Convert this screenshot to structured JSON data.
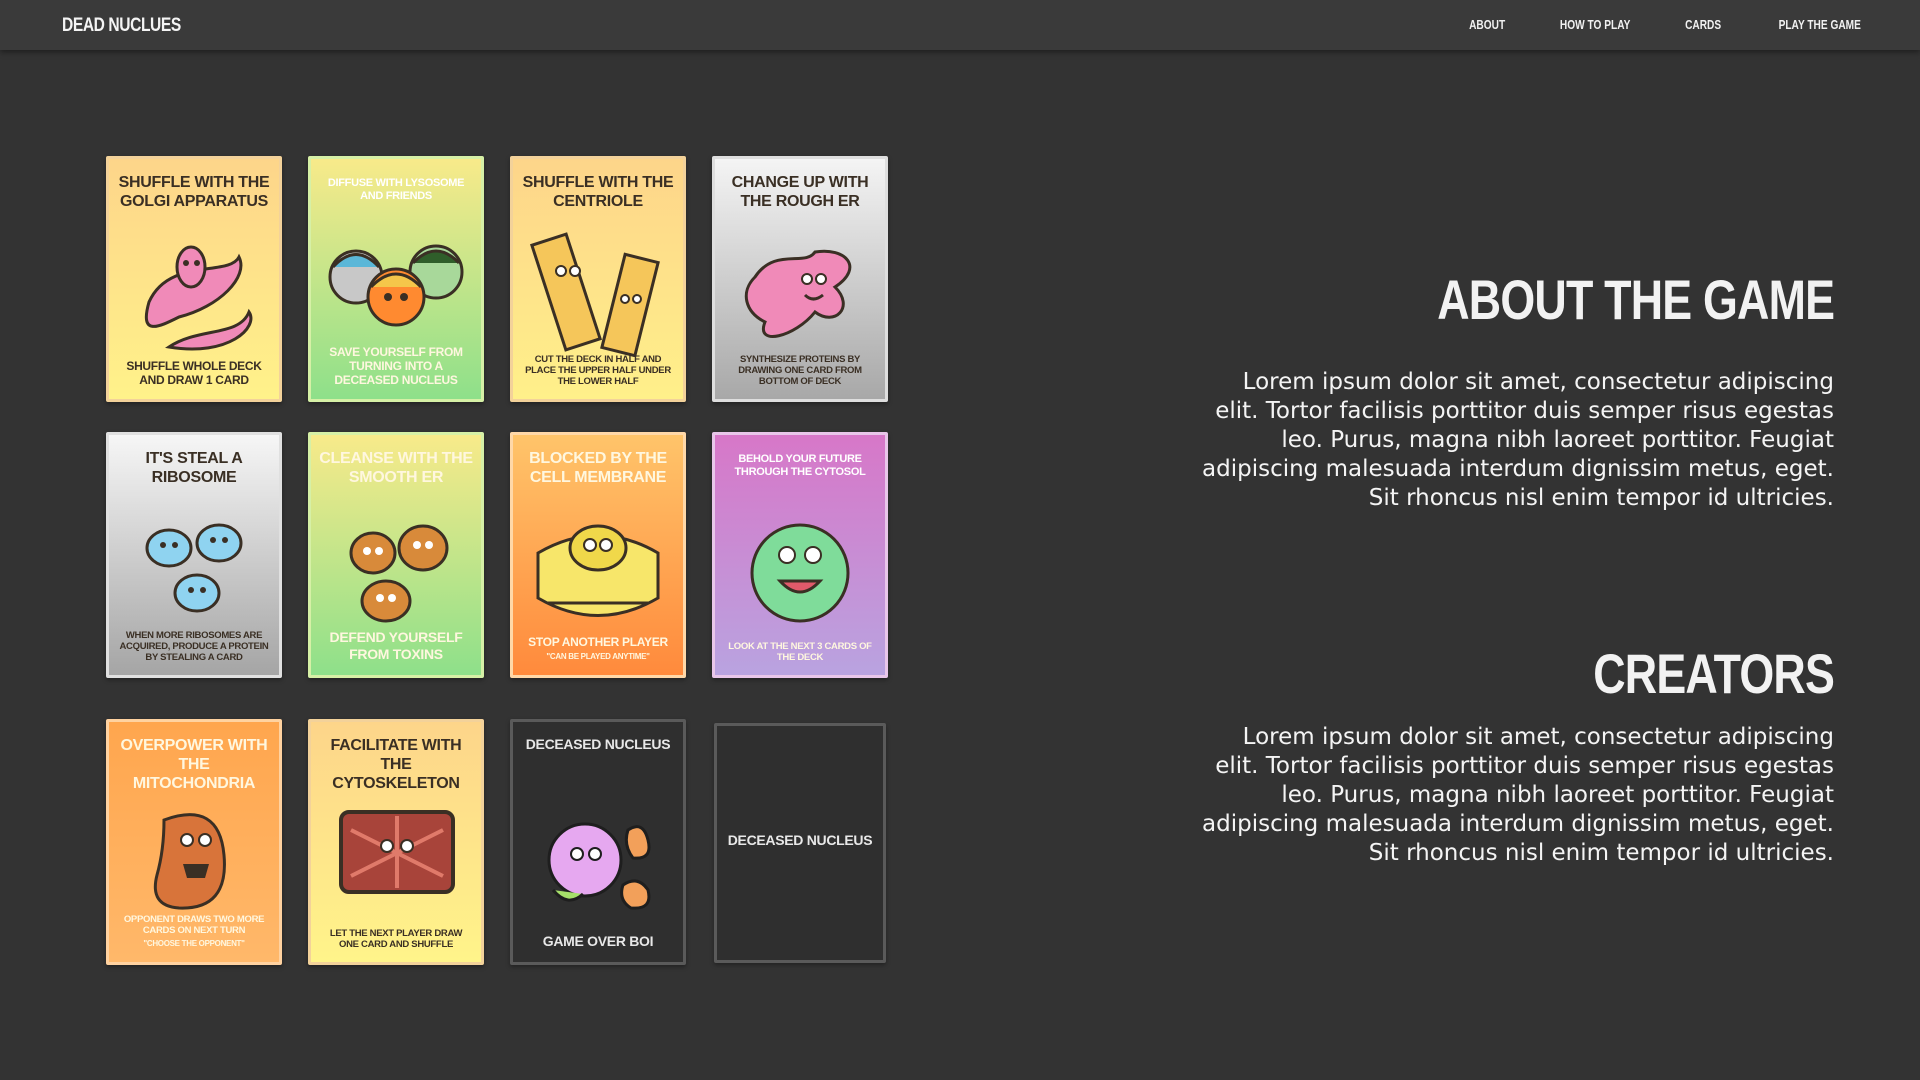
{
  "nav": {
    "brand": "DEAD NUCLUES",
    "links": [
      "ABOUT",
      "HOW TO PLAY",
      "CARDS",
      "PLAY THE GAME"
    ]
  },
  "cards": [
    {
      "title": "SHUFFLE WITH THE GOLGI APPARATUS",
      "footer": "SHUFFLE WHOLE DECK AND DRAW 1 CARD",
      "icon": "golgi-apparatus-icon"
    },
    {
      "title": "DIFFUSE WITH LYSOSOME AND FRIENDS",
      "footer": "SAVE YOURSELF FROM TURNING INTO A DECEASED NUCLEUS",
      "icon": "lysosome-icon"
    },
    {
      "title": "SHUFFLE WITH THE CENTRIOLE",
      "footer": "CUT THE DECK IN HALF AND PLACE THE UPPER HALF UNDER THE LOWER HALF",
      "icon": "centriole-icon"
    },
    {
      "title": "CHANGE UP WITH THE ROUGH ER",
      "footer": "SYNTHESIZE PROTEINS BY DRAWING ONE CARD FROM BOTTOM OF DECK",
      "icon": "rough-er-icon"
    },
    {
      "title": "IT'S STEAL A RIBOSOME",
      "footer": "WHEN MORE RIBOSOMES ARE ACQUIRED, PRODUCE A PROTEIN BY STEALING A CARD",
      "icon": "ribosome-icon"
    },
    {
      "title": "CLEANSE WITH THE SMOOTH ER",
      "footer": "DEFEND YOURSELF FROM TOXINS",
      "icon": "smooth-er-icon"
    },
    {
      "title": "BLOCKED BY THE CELL MEMBRANE",
      "footer": "STOP ANOTHER PLAYER",
      "note": "\"CAN BE PLAYED ANYTIME\"",
      "icon": "cell-membrane-icon"
    },
    {
      "title": "BEHOLD YOUR FUTURE THROUGH THE CYTOSOL",
      "footer": "LOOK AT THE NEXT 3 CARDS OF THE DECK",
      "icon": "cytosol-icon"
    },
    {
      "title": "OVERPOWER WITH THE MITOCHONDRIA",
      "footer": "OPPONENT DRAWS TWO MORE CARDS ON NEXT TURN",
      "note": "\"CHOOSE THE OPPONENT\"",
      "icon": "mitochondria-icon"
    },
    {
      "title": "FACILITATE WITH THE CYTOSKELETON",
      "footer": "LET THE NEXT PLAYER DRAW ONE CARD AND SHUFFLE",
      "icon": "cytoskeleton-icon"
    },
    {
      "title": "DECEASED NUCLEUS",
      "footer": "GAME OVER BOI",
      "icon": "deceased-nucleus-icon"
    },
    {
      "title": "DECEASED NUCLEUS",
      "footer": "",
      "icon": "card-back"
    }
  ],
  "about": {
    "heading": "ABOUT THE GAME",
    "text": "Lorem ipsum dolor sit amet, consectetur adipiscing elit. Tortor facilisis porttitor duis semper risus egestas leo. Purus, magna nibh laoreet porttitor. Feugiat adipiscing malesuada interdum dignissim metus, eget. Sit rhoncus nisl enim tempor id ultricies."
  },
  "creators": {
    "heading": "CREATORS",
    "text": "Lorem ipsum dolor sit amet, consectetur adipiscing elit. Tortor facilisis porttitor duis semper risus egestas leo. Purus, magna nibh laoreet porttitor. Feugiat adipiscing malesuada interdum dignissim metus, eget. Sit rhoncus nisl enim tempor id ultricies."
  },
  "colors": {
    "background": "#333333",
    "navbar": "#3a3a3a",
    "yellow_card": "#fde78a",
    "green_card": "#9fe08a",
    "gray_card": "#cfcfcf",
    "orange_card": "#ff9a4c",
    "purple_card": "#c87fc4",
    "dark_card": "#2f2f2f"
  }
}
